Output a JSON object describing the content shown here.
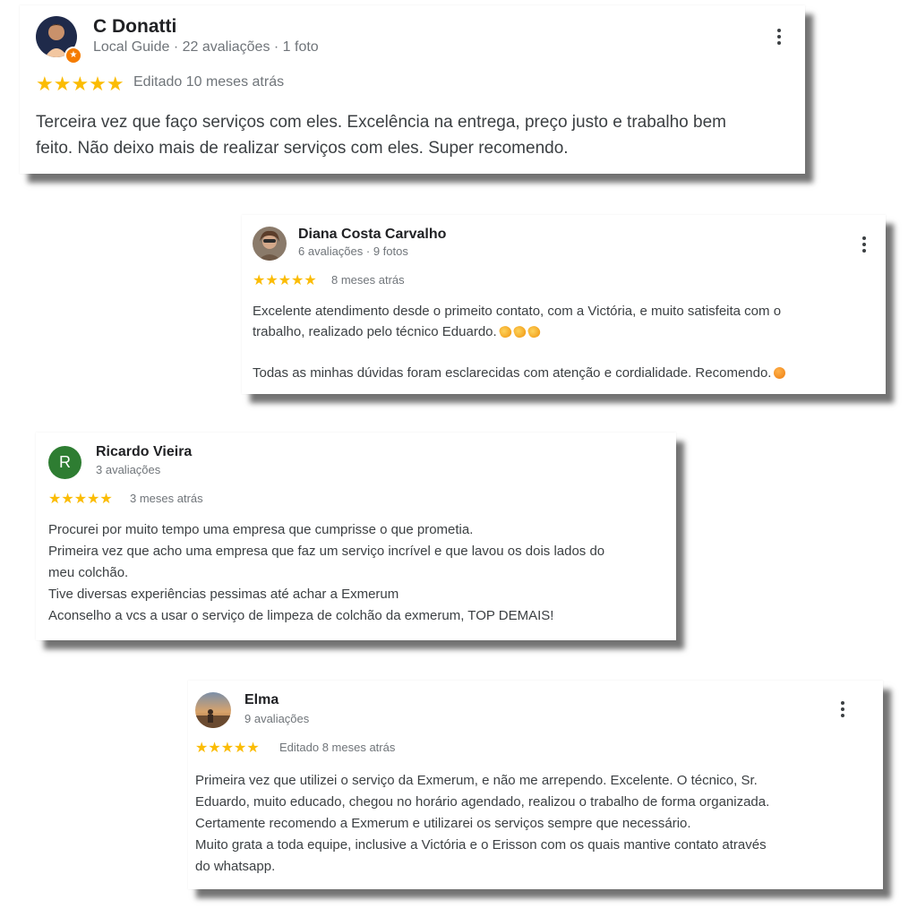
{
  "reviews": [
    {
      "name": "C Donatti",
      "meta": "Local Guide · 22 avaliações · 1 foto",
      "stars": "★★★★★",
      "date": "Editado 10 meses atrás",
      "lines": [
        "Terceira vez que faço serviços com eles. Excelência na entrega, preço justo e trabalho bem",
        "feito. Não deixo mais de realizar serviços com eles. Super recomendo."
      ]
    },
    {
      "name": "Diana Costa Carvalho",
      "meta": "6 avaliações · 9 fotos",
      "stars": "★★★★★",
      "date": "8 meses atrás",
      "lines": [
        "Excelente atendimento desde o primeito contato, com a Victória, e muito satisfeita com o",
        "trabalho, realizado pelo técnico Eduardo.",
        "Todas as minhas dúvidas foram esclarecidas com atenção e cordialidade. Recomendo."
      ]
    },
    {
      "name": "Ricardo Vieira",
      "avatar_letter": "R",
      "meta": "3 avaliações",
      "stars": "★★★★★",
      "date": "3 meses atrás",
      "lines": [
        "Procurei por muito tempo uma empresa que cumprisse o que prometia.",
        "Primeira vez que acho uma empresa que faz um serviço incrível e que lavou os dois lados do",
        "meu colchão.",
        "Tive diversas experiências pessimas até achar a Exmerum",
        "Aconselho a vcs a usar o serviço de limpeza de colchão da exmerum, TOP DEMAIS!"
      ]
    },
    {
      "name": "Elma",
      "meta": "9 avaliações",
      "stars": "★★★★★",
      "date": "Editado 8 meses atrás",
      "lines": [
        "Primeira vez que utilizei o serviço da Exmerum, e não me arrependo. Excelente. O técnico, Sr.",
        "Eduardo, muito educado, chegou no horário agendado, realizou o trabalho de forma organizada.",
        "Certamente recomendo a Exmerum e utilizarei os serviços sempre que necessário.",
        "Muito grata a toda equipe, inclusive a Victória e o Erisson com os quais mantive contato através",
        "do whatsapp."
      ]
    }
  ],
  "colors": {
    "star": "#fbbc04",
    "name": "#202124",
    "meta": "#70757a",
    "text": "#3c4043",
    "avatar_green": "#2e7d32",
    "local_guide_badge": "#f57c00"
  },
  "icons": [
    "more-vert-icon",
    "star-icon",
    "local-guide-badge-icon",
    "clapping-hands-emoji",
    "smiling-face-emoji"
  ]
}
